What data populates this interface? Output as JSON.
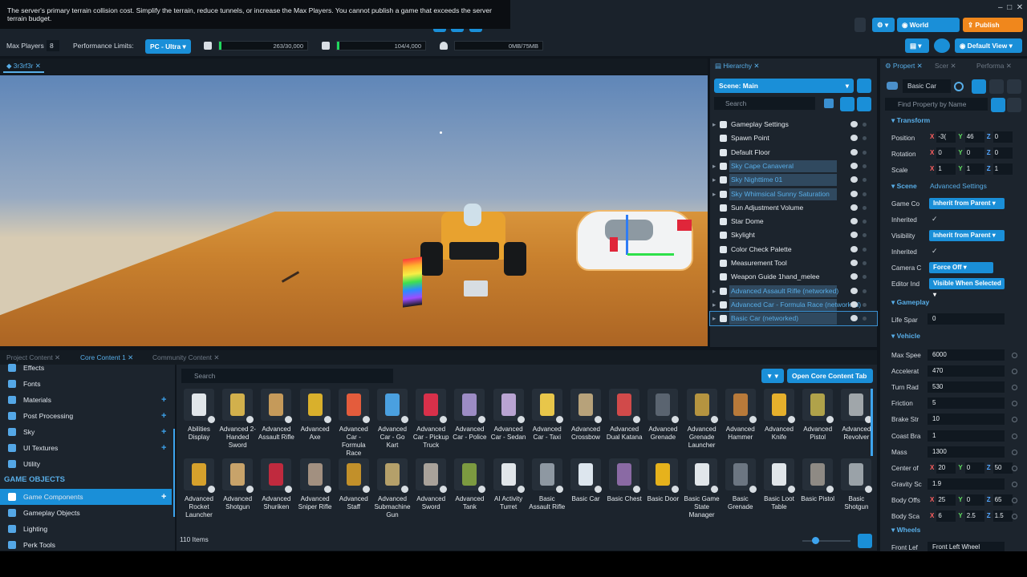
{
  "tooltip": "The server's primary terrain collision cost. Simplify the terrain, reduce tunnels, or increase the Max Players. You cannot publish a game that exceeds the server terrain budget.",
  "toolbar": {
    "world_capture": "World Capture",
    "publish_game": "Publish Game",
    "default_view": "Default View"
  },
  "perf": {
    "max_players_label": "Max Players",
    "max_players_value": "8",
    "performance_limits_label": "Performance Limits:",
    "platform": "PC - Ultra",
    "meter1": "263/30,000",
    "meter2": "104/4,000",
    "meter3": "0MB/75MB"
  },
  "viewport": {
    "tab_label": "3r3rf3r"
  },
  "hierarchy": {
    "tab_label": "Hierarchy",
    "scene_dropdown": "Scene: Main",
    "search_placeholder": "Search",
    "items": [
      "Gameplay Settings",
      "Spawn Point",
      "Default Floor",
      "Sky Cape Canaveral",
      "Sky Nighttime 01",
      "Sky Whimsical Sunny Saturation",
      "Sun Adjustment Volume",
      "Star Dome",
      "Skylight",
      "Color Check Palette",
      "Measurement Tool",
      "Weapon Guide 1hand_melee",
      "Advanced Assault Rifle (networked)",
      "Advanced Car - Formula Race (networked)",
      "Basic Car (networked)"
    ]
  },
  "properties": {
    "tabs": [
      "Propert",
      "Scer",
      "Performa"
    ],
    "object_name": "Basic Car",
    "find_placeholder": "Find Property by Name",
    "transform": {
      "title": "Transform",
      "position": [
        "-3(",
        "46",
        "0"
      ],
      "rotation": [
        "0",
        "0",
        "0"
      ],
      "scale": [
        "1",
        "1",
        "1"
      ]
    },
    "scene": {
      "title": "Scene",
      "advanced": "Advanced Settings",
      "game_co_label": "Game Co",
      "game_co_value": "Inherit from Parent",
      "inherited_label": "Inherited",
      "visibility_label": "Visibility",
      "visibility_value": "Inherit from Parent",
      "camera_label": "Camera C",
      "camera_value": "Force Off",
      "editor_label": "Editor Ind",
      "editor_value": "Visible When Selected"
    },
    "gameplay": {
      "title": "Gameplay",
      "life_span_label": "Life Spar",
      "life_span_value": "0"
    },
    "vehicle": {
      "title": "Vehicle",
      "max_speed_label": "Max Spee",
      "max_speed": "6000",
      "accel_label": "Accelerat",
      "accel": "470",
      "turn_label": "Turn Rad",
      "turn": "530",
      "friction_label": "Friction",
      "friction": "5",
      "brake_label": "Brake Str",
      "brake": "10",
      "coast_label": "Coast Bra",
      "coast": "1",
      "mass_label": "Mass",
      "mass": "1300",
      "com_label": "Center of",
      "com": [
        "20",
        "0",
        "50"
      ],
      "gravity_label": "Gravity Sc",
      "gravity": "1.9",
      "body_off_label": "Body Offs",
      "body_off": [
        "25",
        "0",
        "65"
      ],
      "body_scale_label": "Body Sca",
      "body_scale": [
        "6",
        "2.5",
        "1.5"
      ]
    },
    "wheels": {
      "title": "Wheels",
      "front_left_label": "Front Lef",
      "front_left_value": "Front Left Wheel"
    }
  },
  "content": {
    "tabs": [
      "Project Content",
      "Core Content 1",
      "Community Content"
    ],
    "search_placeholder": "Search",
    "open_tab_button": "Open Core Content Tab",
    "item_count": "110 Items",
    "left": [
      "Effects",
      "Fonts",
      "Materials",
      "Post Processing",
      "Sky",
      "UI Textures",
      "Utility"
    ],
    "section": "GAME OBJECTS",
    "left2": [
      "Game Components",
      "Gameplay Objects",
      "Lighting",
      "Perk Tools"
    ],
    "row1": [
      "Abilities Display",
      "Advanced 2-Handed Sword",
      "Advanced Assault Rifle",
      "Advanced Axe",
      "Advanced Car - Formula Race",
      "Advanced Car - Go Kart",
      "Advanced Car - Pickup Truck",
      "Advanced Car - Police",
      "Advanced Car - Sedan",
      "Advanced Car - Taxi",
      "Advanced Crossbow",
      "Advanced Dual Katana",
      "Advanced Grenade",
      "Advanced Grenade Launcher",
      "Advanced Hammer",
      "Advanced Knife",
      "Advanced Pistol",
      "Advanced Revolver"
    ],
    "row2": [
      "Advanced Rocket Launcher",
      "Advanced Shotgun",
      "Advanced Shuriken",
      "Advanced Sniper Rifle",
      "Advanced Staff",
      "Advanced Submachine Gun",
      "Advanced Sword",
      "Advanced Tank",
      "AI Activity Turret",
      "Basic Assault Rifle",
      "Basic Car",
      "Basic Chest",
      "Basic Door",
      "Basic Game State Manager",
      "Basic Grenade",
      "Basic Loot Table",
      "Basic Pistol",
      "Basic Shotgun"
    ]
  },
  "colors": {
    "accent": "#1a8fd8",
    "publish": "#f0871c",
    "meter_fill": "#20d75d"
  }
}
